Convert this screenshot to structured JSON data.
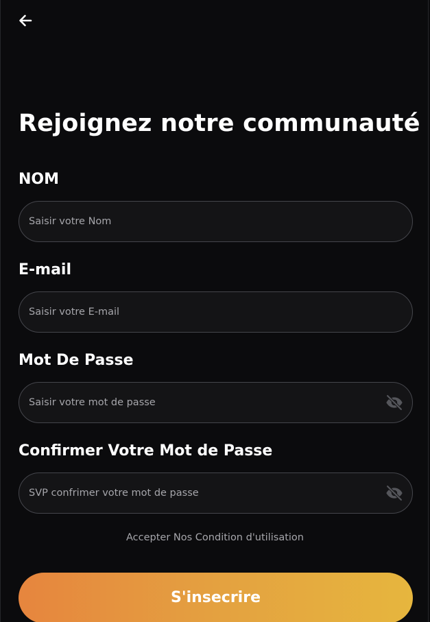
{
  "header": {
    "back_icon": "arrow-left-icon"
  },
  "form": {
    "title": "Rejoignez notre communauté !",
    "fields": [
      {
        "label": "NOM",
        "placeholder": "Saisir votre Nom",
        "value": ""
      },
      {
        "label": "E-mail",
        "placeholder": "Saisir votre E-mail",
        "value": ""
      },
      {
        "label": "Mot De Passe",
        "placeholder": "Saisir votre mot de passe",
        "value": "",
        "icon": "eye-off-icon"
      },
      {
        "label": "Confirmer Votre Mot de Passe",
        "placeholder": "SVP confrimer votre mot de passe",
        "value": "",
        "icon": "eye-off-icon"
      }
    ],
    "terms_text": "Accepter Nos Condition d'utilisation",
    "submit_label": "S'insecrire"
  },
  "colors": {
    "background": "#0b0b0d",
    "field_background": "#141416",
    "field_border": "#45464c",
    "placeholder": "#a6a6ab",
    "button_gradient_start": "#e6853e",
    "button_gradient_end": "#e6b63e"
  }
}
